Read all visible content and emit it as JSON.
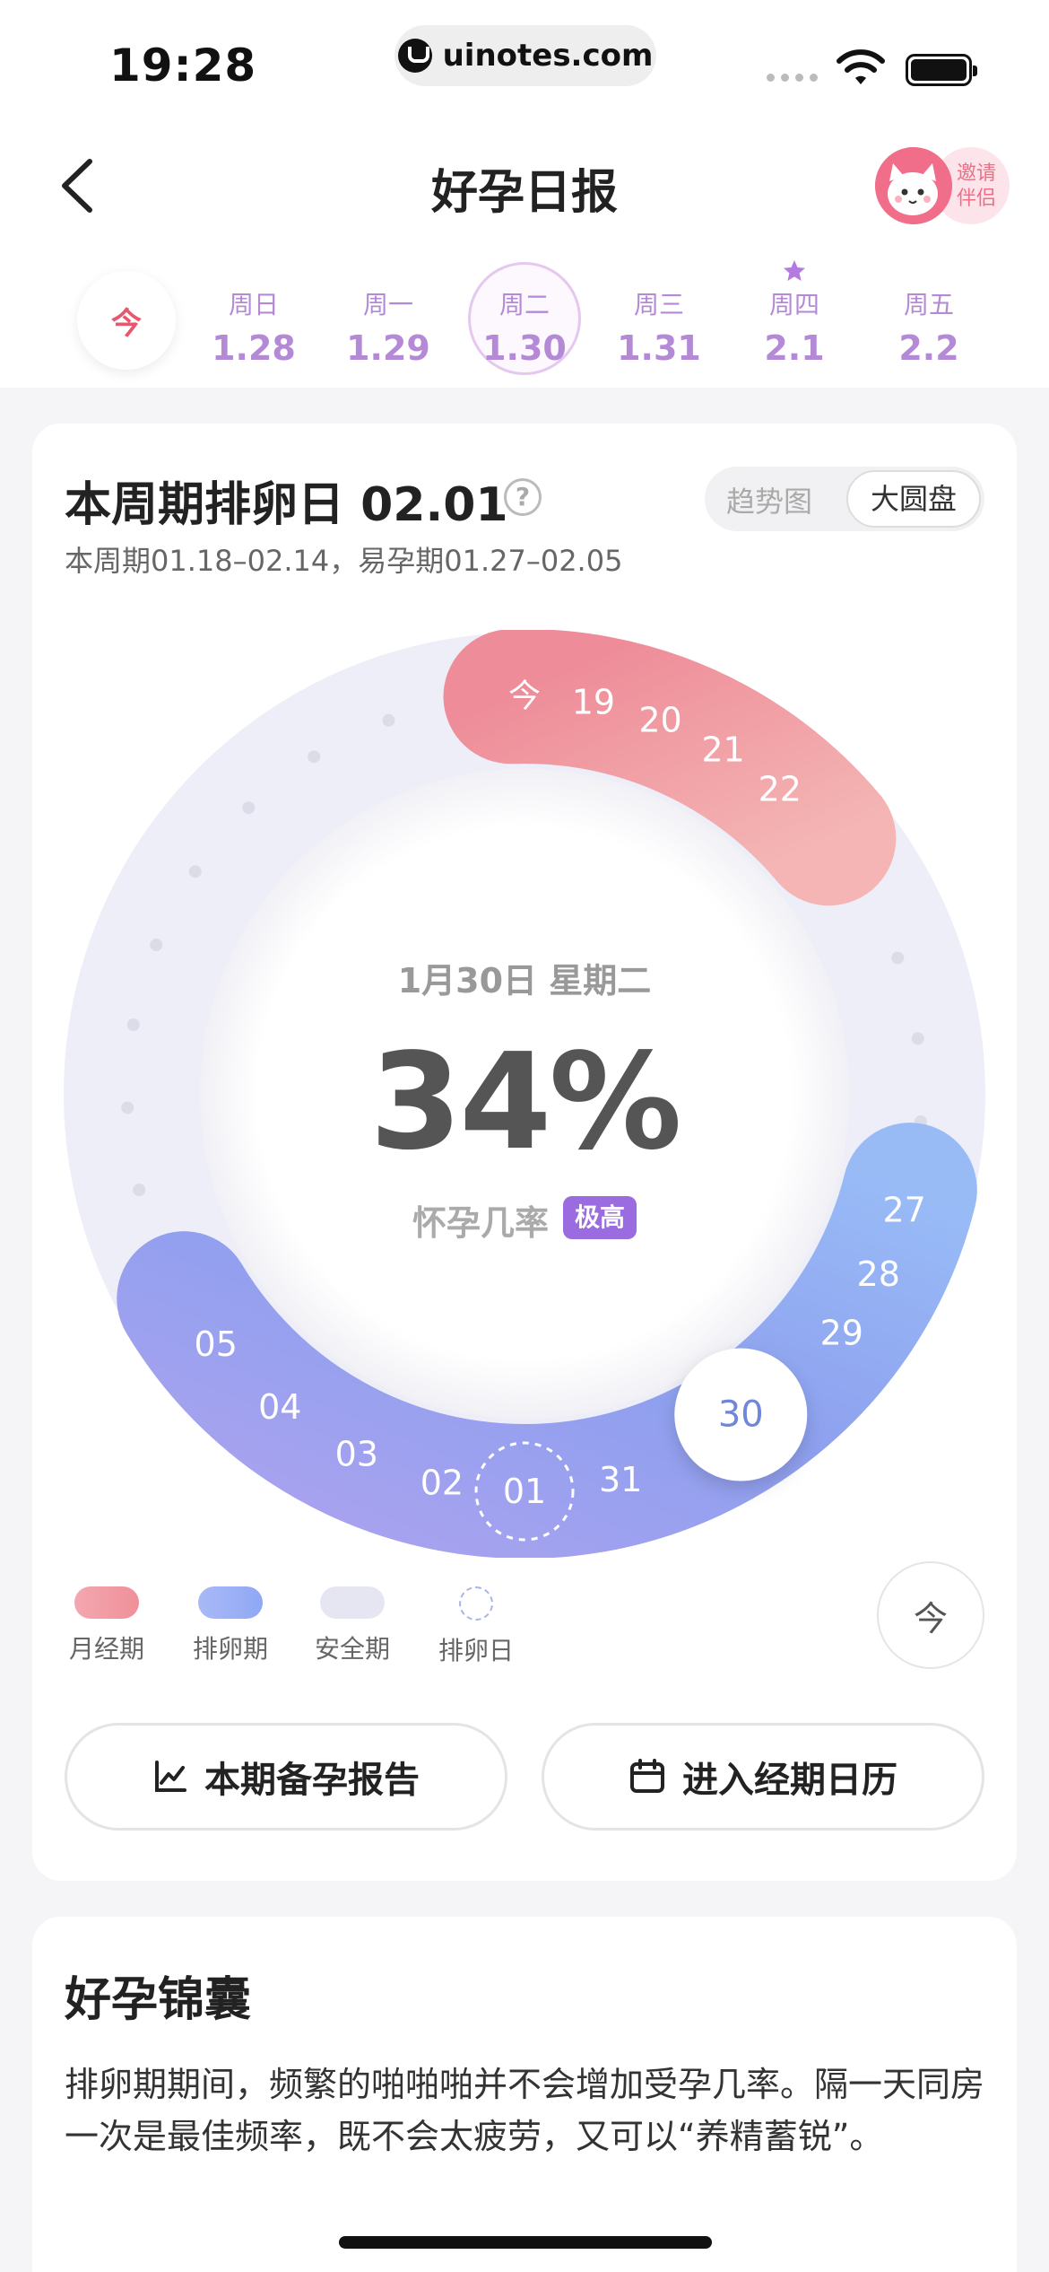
{
  "status_bar": {
    "time": "19:28",
    "url": "uinotes.com"
  },
  "header": {
    "title": "好孕日报",
    "invite_label": "邀请\n伴侣",
    "invite_line1": "邀请",
    "invite_line2": "伴侣"
  },
  "week_strip": {
    "today_label": "今",
    "days": [
      {
        "weekday": "周日",
        "date": "1.28"
      },
      {
        "weekday": "周一",
        "date": "1.29"
      },
      {
        "weekday": "周二",
        "date": "1.30",
        "selected": true
      },
      {
        "weekday": "周三",
        "date": "1.31"
      },
      {
        "weekday": "周四",
        "date": "2.1",
        "starred": true
      },
      {
        "weekday": "周五",
        "date": "2.2"
      }
    ]
  },
  "cycle_card": {
    "title": "本周期排卵日 02.01",
    "subtitle": "本周期01.18–02.14，易孕期01.27–02.05",
    "help_icon": "question-icon",
    "view_toggle": {
      "options": [
        "趋势图",
        "大圆盘"
      ],
      "selected": "大圆盘"
    },
    "dial": {
      "today_marker": "今",
      "period_days": [
        "19",
        "20",
        "21",
        "22"
      ],
      "ovulation_days": [
        "27",
        "28",
        "29",
        "30",
        "31",
        "01",
        "02",
        "03",
        "04",
        "05"
      ],
      "ovulation_day": "01",
      "current_day": "30",
      "colors": {
        "period": "#ef8f99",
        "ovulation": "#8fa8f5",
        "safe": "#ebebf7",
        "accent": "#9b6be0"
      }
    },
    "center": {
      "date": "1月30日  星期二",
      "probability": "34%",
      "probability_label": "怀孕几率",
      "level_badge": "极高"
    },
    "legend": [
      {
        "label": "月经期",
        "color": "#f29aa5"
      },
      {
        "label": "排卵期",
        "color": "#9fb4f5"
      },
      {
        "label": "安全期",
        "color": "#e6e6f2"
      },
      {
        "label": "排卵日",
        "color": "#a7b4e6"
      }
    ],
    "today_button": "今",
    "buttons": {
      "report": "本期备孕报告",
      "calendar": "进入经期日历"
    }
  },
  "tips": {
    "title": "好孕锦囊",
    "text": "排卵期期间，频繁的啪啪啪并不会增加受孕几率。隔一天同房一次是最佳频率，既不会太疲劳，又可以“养精蓄锐”。"
  }
}
